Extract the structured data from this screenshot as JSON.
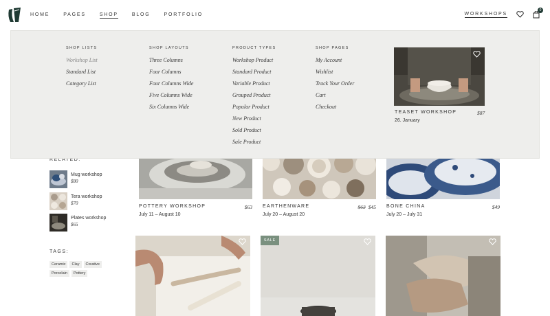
{
  "nav": {
    "items": [
      "HOME",
      "PAGES",
      "SHOP",
      "BLOG",
      "PORTFOLIO"
    ],
    "active": "SHOP",
    "workshops_link": "WORKSHOPS",
    "cart_count": "0"
  },
  "mega_menu": {
    "columns": [
      {
        "title": "SHOP LISTS",
        "links": [
          "Workshop List",
          "Standard List",
          "Category List"
        ]
      },
      {
        "title": "SHOP LAYOUTS",
        "links": [
          "Three Columns",
          "Four Columns",
          "Four Columns Wide",
          "Five Columns Wide",
          "Six Columns Wide"
        ]
      },
      {
        "title": "PRODUCT TYPES",
        "links": [
          "Workshop Product",
          "Standard Product",
          "Variable Product",
          "Grouped Product",
          "Popular Product",
          "New Product",
          "Sold Product",
          "Sale Product"
        ]
      },
      {
        "title": "SHOP PAGES",
        "links": [
          "My Account",
          "Wishlist",
          "Track Your Order",
          "Cart",
          "Checkout"
        ]
      }
    ],
    "feature": {
      "title": "TEASET WORKSHOP",
      "price": "$87",
      "date": "26. January"
    }
  },
  "sidebar": {
    "related_heading": "RELATED:",
    "related": [
      {
        "name": "Mug workshop",
        "price": "$80"
      },
      {
        "name": "Tera workshop",
        "price": "$70"
      },
      {
        "name": "Plates workshop",
        "price": "$65"
      }
    ],
    "tags_heading": "TAGS:",
    "tags": [
      "Ceramic",
      "Clay",
      "Creative",
      "Porcelain",
      "Pottery"
    ]
  },
  "products": [
    {
      "title": "POTTERY WORKSHOP",
      "price": "$63",
      "old_price": "",
      "date": "July 11 – August 10"
    },
    {
      "title": "EARTHENWARE",
      "price": "$45",
      "old_price": "$63",
      "date": "July 20 – August 20"
    },
    {
      "title": "BONE CHINA",
      "price": "$49",
      "old_price": "",
      "date": "July 20 – July 31"
    }
  ],
  "sale_badge": "SALE",
  "colors": {
    "accent": "#1f3a33",
    "menu_bg": "#eeeeec",
    "sale": "#7a907f"
  }
}
